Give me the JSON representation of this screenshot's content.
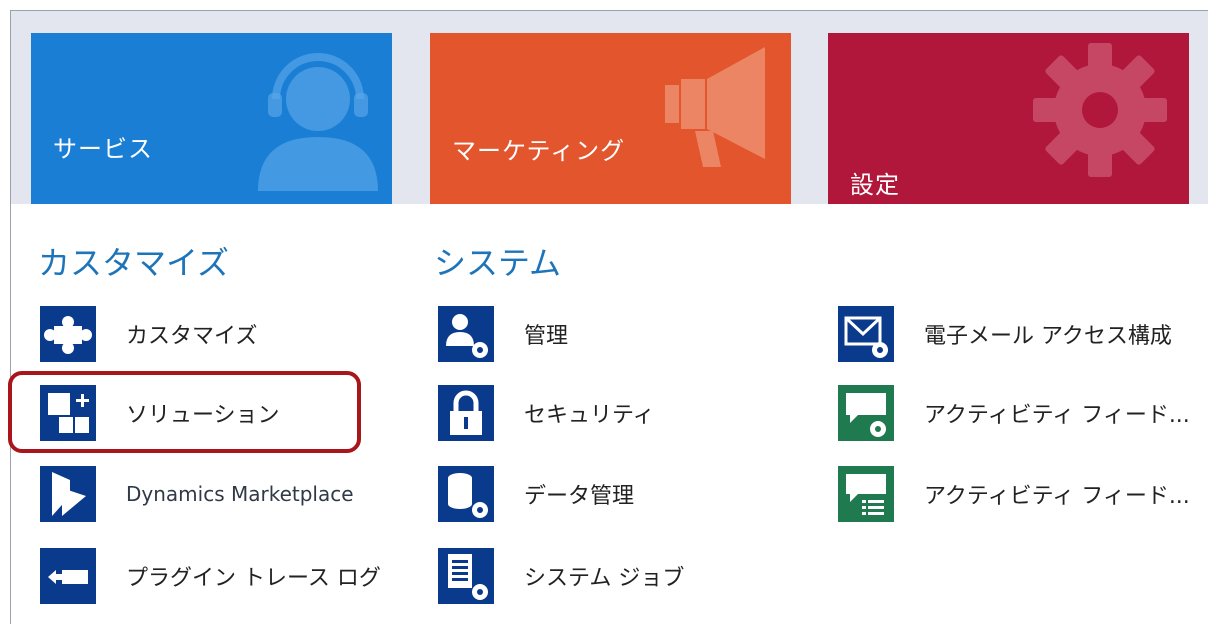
{
  "tiles": [
    {
      "label": "サービス",
      "color": "#1a7fd4",
      "icon": "person-headset-icon"
    },
    {
      "label": "マーケティング",
      "color": "#e2552d",
      "icon": "megaphone-icon"
    },
    {
      "label": "設定",
      "color": "#b1173a",
      "icon": "gear-icon"
    }
  ],
  "sections": {
    "customize": {
      "heading": "カスタマイズ",
      "items": [
        {
          "label": "カスタマイズ",
          "icon": "puzzle-icon"
        },
        {
          "label": "ソリューション",
          "icon": "solution-blocks-icon"
        },
        {
          "label": "Dynamics Marketplace",
          "icon": "dynamics-logo-icon"
        },
        {
          "label": "プラグイン トレース ログ",
          "icon": "plugin-trace-icon"
        }
      ]
    },
    "system": {
      "heading": "システム",
      "items": [
        {
          "label": "管理",
          "icon": "users-gear-icon"
        },
        {
          "label": "セキュリティ",
          "icon": "padlock-icon"
        },
        {
          "label": "データ管理",
          "icon": "database-gear-icon"
        },
        {
          "label": "システム ジョブ",
          "icon": "document-gear-icon"
        }
      ]
    },
    "other": {
      "items": [
        {
          "label": "電子メール アクセス構成",
          "icon": "mail-gear-icon"
        },
        {
          "label": "アクティビティ フィード...",
          "icon": "feed-gear-icon"
        },
        {
          "label": "アクティビティ フィード...",
          "icon": "feed-list-icon"
        }
      ]
    }
  },
  "colors": {
    "heading": "#1e74b8",
    "icon_blue": "#0a3a8c",
    "icon_green": "#1f7a4f",
    "highlight": "#a8161c"
  }
}
